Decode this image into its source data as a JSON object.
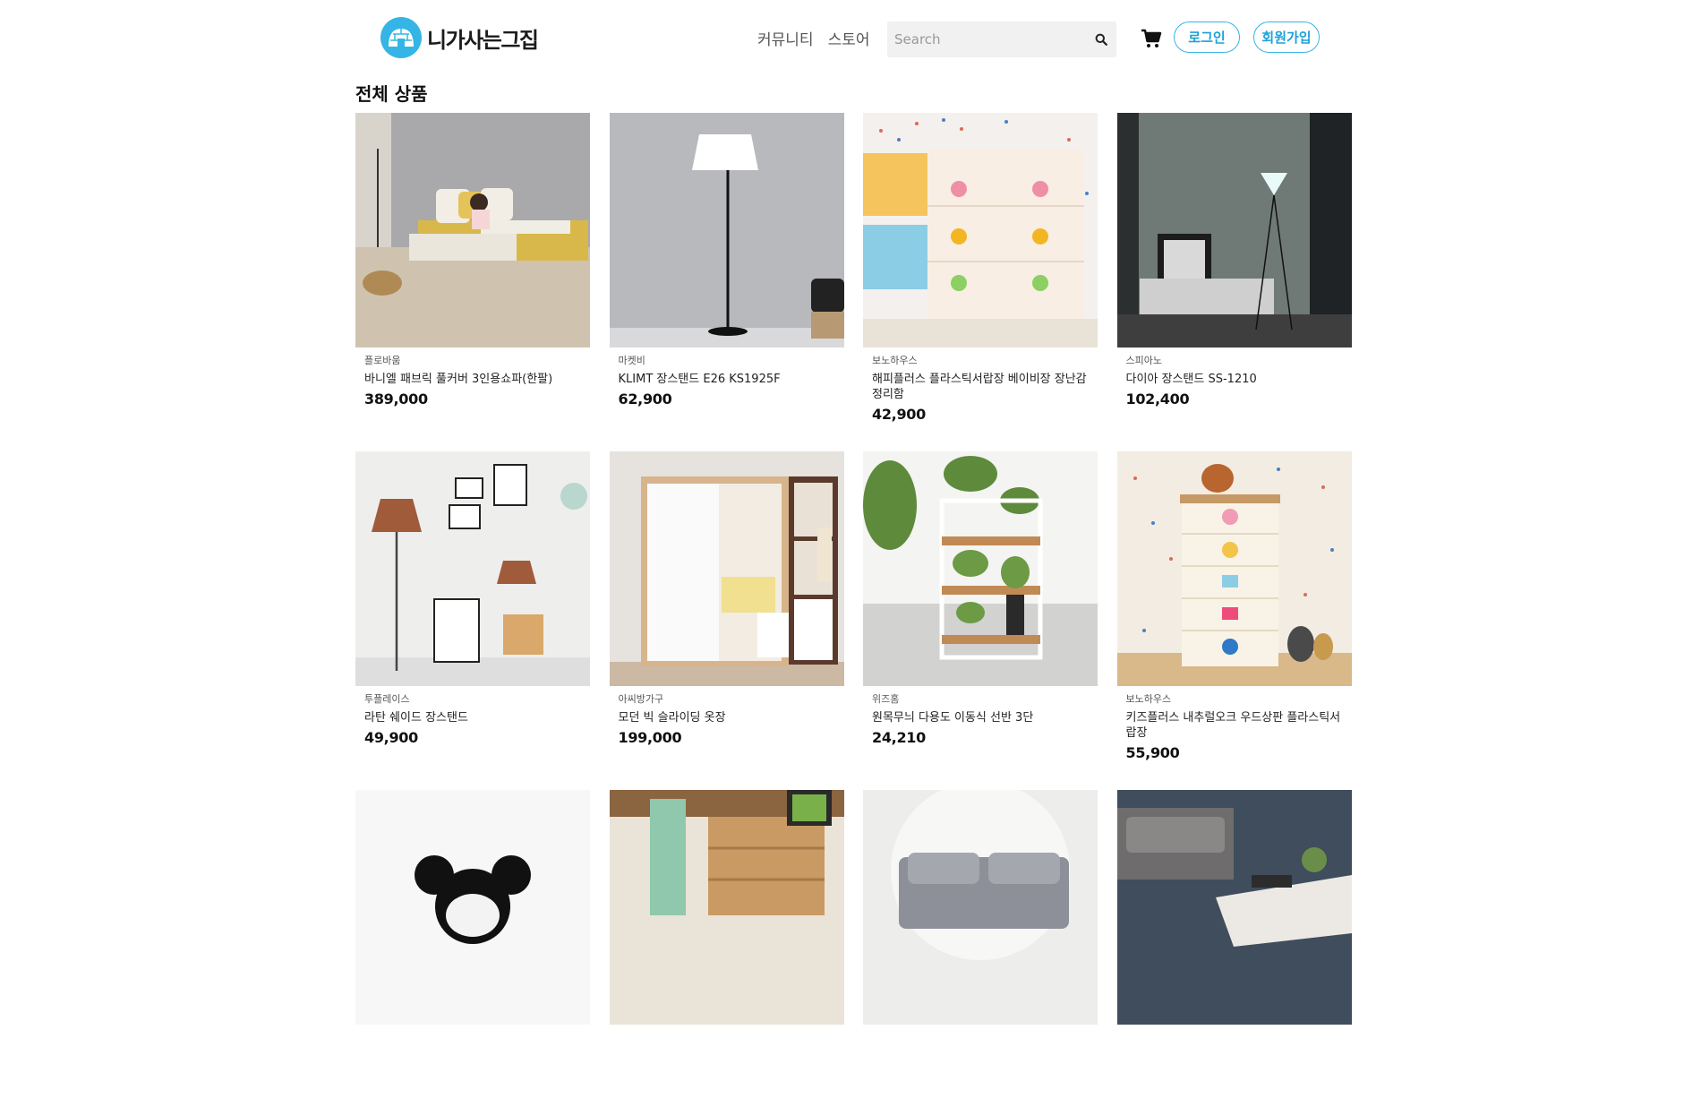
{
  "header": {
    "logo_text": "니가사는그집",
    "nav": [
      "커뮤니티",
      "스토어"
    ],
    "search": {
      "placeholder": "Search",
      "value": ""
    },
    "login_label": "로그인",
    "signup_label": "회원가입"
  },
  "section_title": "전체 상품",
  "colors": {
    "accent": "#35b5e5"
  },
  "products": [
    {
      "brand": "플로바움",
      "name": "바니엘 패브릭 풀커버 3인용쇼파(한팔)",
      "price": "389,000",
      "image": "yellow-sofa"
    },
    {
      "brand": "마켓비",
      "name": "KLIMT 장스탠드 E26 KS1925F",
      "price": "62,900",
      "image": "floor-lamp"
    },
    {
      "brand": "보노하우스",
      "name": "해피플러스 플라스틱서랍장 베이비장 장난감정리함",
      "price": "42,900",
      "image": "smiley-drawers"
    },
    {
      "brand": "스피아노",
      "name": "다이아 장스탠드 SS-1210",
      "price": "102,400",
      "image": "diamond-lamp"
    },
    {
      "brand": "투플레이스",
      "name": "라탄 쉐이드 장스탠드",
      "price": "49,900",
      "image": "rattan-lamp"
    },
    {
      "brand": "아씨방가구",
      "name": "모던 빅 슬라이딩 옷장",
      "price": "199,000",
      "image": "sliding-wardrobe"
    },
    {
      "brand": "위즈홈",
      "name": "원목무늬 다용도 이동식 선반 3단",
      "price": "24,210",
      "image": "plant-shelf"
    },
    {
      "brand": "보노하우스",
      "name": "키즈플러스 내추럴오크 우드상판 플라스틱서랍장",
      "price": "55,900",
      "image": "kids-drawers"
    },
    {
      "brand": "",
      "name": "",
      "price": "",
      "image": "mickey-lamp"
    },
    {
      "brand": "",
      "name": "",
      "price": "",
      "image": "wood-bookshelf"
    },
    {
      "brand": "",
      "name": "",
      "price": "",
      "image": "grey-sofa"
    },
    {
      "brand": "",
      "name": "",
      "price": "",
      "image": "coffee-table"
    }
  ]
}
